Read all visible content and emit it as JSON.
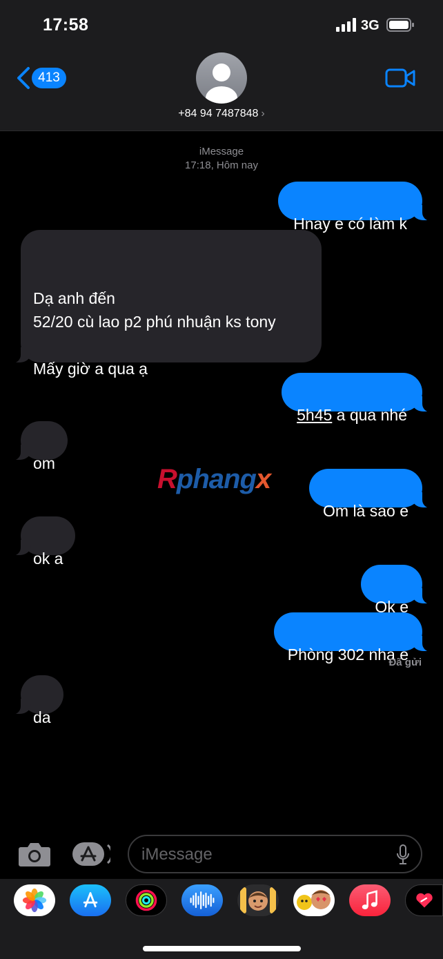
{
  "status_bar": {
    "time": "17:58",
    "network": "3G"
  },
  "header": {
    "back_count": "413",
    "contact": "+84 94 7487848"
  },
  "conversation": {
    "service": "iMessage",
    "timestamp": "17:18, Hôm nay",
    "messages": [
      {
        "from": "me",
        "text": "Hnay e có làm k"
      },
      {
        "from": "them",
        "text": "\nDạ anh đến\n52/20 cù lao p2 phú nhuận ks tony\n\nMấy giờ a qua ạ"
      },
      {
        "from": "me",
        "link": "5h45",
        "text": " a qua nhé"
      },
      {
        "from": "them",
        "text": "om"
      },
      {
        "from": "me",
        "text": "Om là sao e"
      },
      {
        "from": "them",
        "text": "ok a"
      },
      {
        "from": "me",
        "text": "Ok e"
      },
      {
        "from": "me",
        "text": "Phòng 302 nha e"
      },
      {
        "from": "them",
        "text": "da"
      }
    ],
    "delivered_label": "Đã gửi"
  },
  "watermark": {
    "part1": "R",
    "part2": "phang",
    "part3": "x"
  },
  "input": {
    "placeholder": "iMessage"
  },
  "app_drawer": {
    "apps": [
      "photos-app",
      "app-store-app",
      "activity-app",
      "audio-message-app",
      "memoji-app",
      "memoji-stickers-app",
      "music-app",
      "digital-touch-app"
    ]
  },
  "colors": {
    "accent": "#0a84ff",
    "incoming_bubble": "#26252a",
    "background": "#000000"
  }
}
